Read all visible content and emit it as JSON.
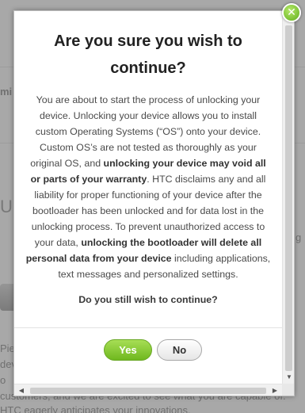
{
  "background": {
    "text_mi": "mi",
    "text_u": "U",
    "text_g": "g",
    "text_pie": "Pie",
    "text_dev": "dev",
    "text_o": "o",
    "text_customers": "customers, and we are excited to see what you are capable of.",
    "text_htc": "HTC eagerly anticipates your innovations."
  },
  "dialog": {
    "title": "Are you sure you wish to continue?",
    "body": {
      "p1": "You are about to start the process of unlocking your device. Unlocking your device allows you to install custom Operating Systems (“OS”) onto your device. Custom OS’s are not tested as thoroughly as your original OS, and ",
      "bold1": "unlocking your device may void all or parts of your warranty",
      "p2": ". HTC disclaims any and all liability for proper functioning of your device after the bootloader has been unlocked and for data lost in the unlocking process. To prevent unauthorized access to your data, ",
      "bold2": "unlocking the bootloader will delete all personal data from your device",
      "p3": " including applications, text messages and personalized settings."
    },
    "question": "Do you still wish to continue?",
    "yes_label": "Yes",
    "no_label": "No",
    "close_icon": "✕",
    "scroll_up_glyph": "▲",
    "scroll_down_glyph": "▼",
    "scroll_left_glyph": "◀",
    "scroll_right_glyph": "▶"
  },
  "colors": {
    "yes_button": "#7cc22a",
    "close_button": "#6cbf22",
    "overlay": "#505050"
  }
}
